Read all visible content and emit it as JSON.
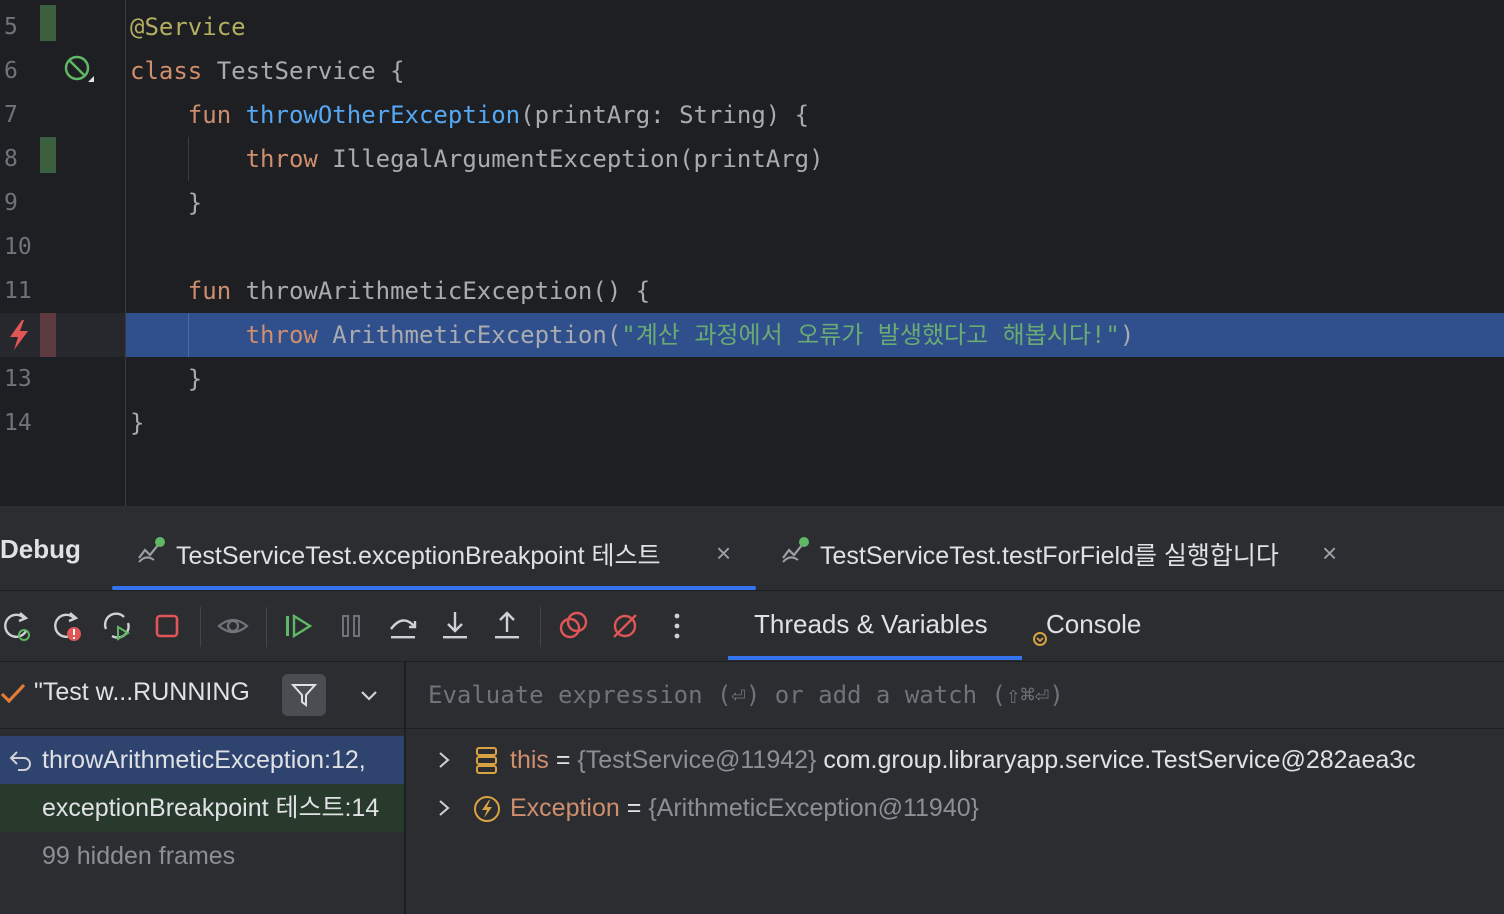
{
  "editor": {
    "lines": [
      {
        "num": "5",
        "tokens": [
          {
            "t": "@Service",
            "c": "ann"
          }
        ]
      },
      {
        "num": "6",
        "tokens": [
          {
            "t": "class ",
            "c": "kw"
          },
          {
            "t": "TestService {",
            "c": "dim"
          }
        ]
      },
      {
        "num": "7",
        "tokens": [
          {
            "t": "    fun ",
            "c": "kw"
          },
          {
            "t": "throwOtherException",
            "c": "fn"
          },
          {
            "t": "(printArg: String) {",
            "c": "dim"
          }
        ]
      },
      {
        "num": "8",
        "tokens": [
          {
            "t": "        throw ",
            "c": "kw"
          },
          {
            "t": "IllegalArgumentException(printArg)",
            "c": "dim"
          }
        ]
      },
      {
        "num": "9",
        "tokens": [
          {
            "t": "    }",
            "c": "dim"
          }
        ]
      },
      {
        "num": "10",
        "tokens": []
      },
      {
        "num": "11",
        "tokens": [
          {
            "t": "    fun ",
            "c": "kw"
          },
          {
            "t": "throwArithmeticException",
            "c": "dim2"
          },
          {
            "t": "() {",
            "c": "dim"
          }
        ]
      },
      {
        "num": "12",
        "tokens": [
          {
            "t": "        throw ",
            "c": "kw"
          },
          {
            "t": "ArithmeticException(",
            "c": "dim"
          },
          {
            "t": "\"계산 과정에서 오류가 발생했다고 해봅시다!\"",
            "c": "str"
          },
          {
            "t": ")",
            "c": "dim"
          }
        ],
        "highlighted": true
      },
      {
        "num": "13",
        "tokens": [
          {
            "t": "    }",
            "c": "dim"
          }
        ]
      },
      {
        "num": "14",
        "tokens": [
          {
            "t": "}",
            "c": "dim"
          }
        ]
      }
    ]
  },
  "debug": {
    "title": "Debug",
    "tabs": [
      {
        "label": "TestServiceTest.exceptionBreakpoint 테스트",
        "close": "×"
      },
      {
        "label": "TestServiceTest.testForField를 실행합니다",
        "close": "×"
      }
    ],
    "subtabs": {
      "threads_variables": "Threads & Variables",
      "console": "Console"
    },
    "thread": {
      "label": "\"Test w...RUNNING"
    },
    "frames": [
      {
        "label": "throwArithmeticException:12,"
      },
      {
        "label": "exceptionBreakpoint 테스트:14"
      },
      {
        "label": "99 hidden frames"
      }
    ],
    "eval_placeholder": "Evaluate expression (⏎) or add a watch (⇧⌘⏎)",
    "variables": [
      {
        "name": "this",
        "eq": "=",
        "type": "{TestService@11942}",
        "value": "com.group.libraryapp.service.TestService@282aea3c"
      },
      {
        "name": "Exception",
        "eq": "=",
        "type": "{ArithmeticException@11940}",
        "value": ""
      }
    ]
  },
  "colors": {
    "accent": "#3574f0",
    "highlight": "#2f4f8d",
    "keyword": "#cf8e6d",
    "function": "#56a8f5",
    "string": "#6aab73"
  }
}
